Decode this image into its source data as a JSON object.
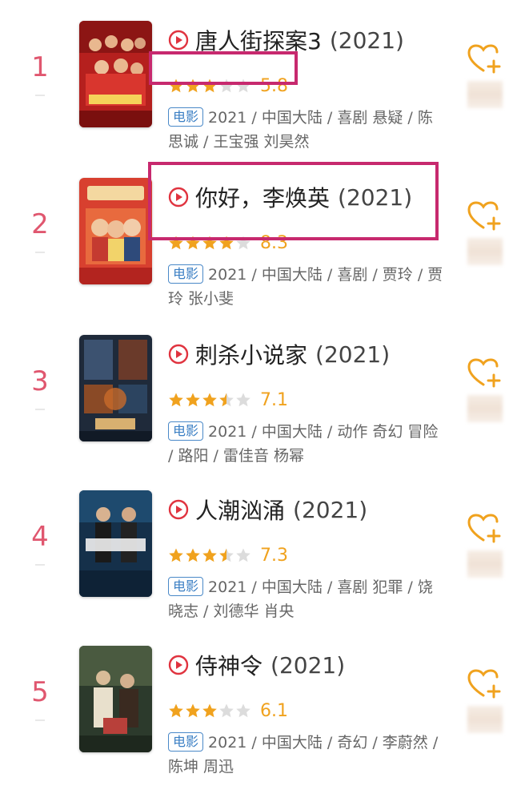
{
  "items": [
    {
      "rank": "1",
      "title": "唐人街探案3",
      "year": "(2021)",
      "stars": 3,
      "score": "5.8",
      "tag": "电影",
      "meta": "2021 / 中国大陆 / 喜剧 悬疑 / 陈思诚 / 王宝强 刘昊然"
    },
    {
      "rank": "2",
      "title": "你好，李焕英",
      "year": "(2021)",
      "stars": 4,
      "score": "8.3",
      "tag": "电影",
      "meta": "2021 / 中国大陆 / 喜剧 / 贾玲 / 贾玲 张小斐"
    },
    {
      "rank": "3",
      "title": "刺杀小说家",
      "year": "(2021)",
      "stars": 3.5,
      "score": "7.1",
      "tag": "电影",
      "meta": "2021 / 中国大陆 / 动作 奇幻 冒险 / 路阳 / 雷佳音 杨幂"
    },
    {
      "rank": "4",
      "title": "人潮汹涌",
      "year": "(2021)",
      "stars": 3.5,
      "score": "7.3",
      "tag": "电影",
      "meta": "2021 / 中国大陆 / 喜剧 犯罪 / 饶晓志 / 刘德华 肖央"
    },
    {
      "rank": "5",
      "title": "侍神令",
      "year": "(2021)",
      "stars": 3,
      "score": "6.1",
      "tag": "电影",
      "meta": "2021 / 中国大陆 / 奇幻 / 李蔚然 / 陈坤 周迅"
    }
  ],
  "icons": {
    "play": "play-circle-icon",
    "favorite": "heart-plus-icon",
    "star": "star-icon"
  },
  "colors": {
    "rank": "#e0576f",
    "star": "#f0a21e",
    "tag": "#3b7fc4",
    "highlight": "#c7296e",
    "heart": "#f0a21e",
    "play": "#e0333f"
  }
}
